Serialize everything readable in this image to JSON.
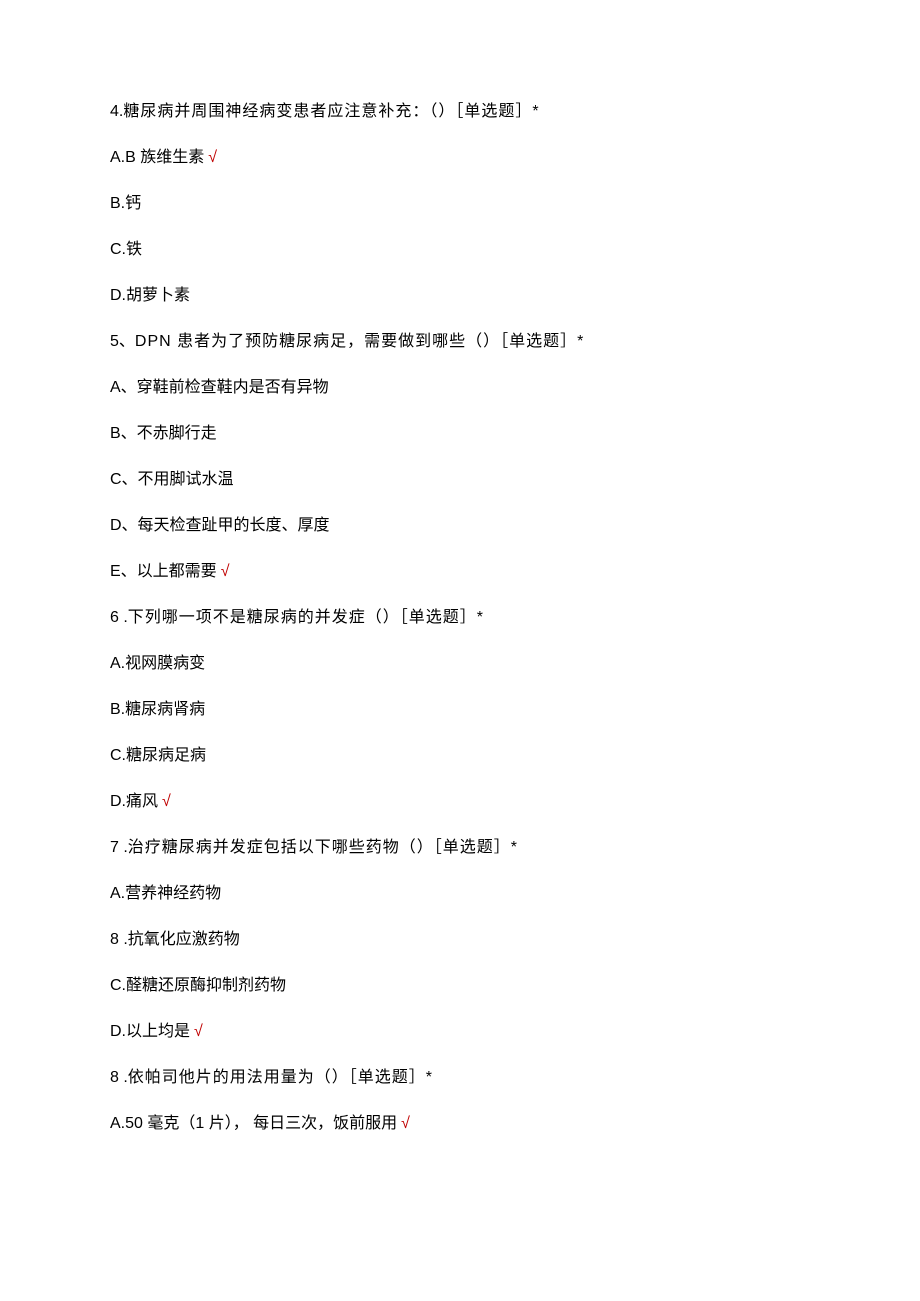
{
  "questions": [
    {
      "number": "4",
      "sep": ".",
      "text": "糖尿病并周围神经病变患者应注意补充：（）［单选题］*",
      "options": [
        {
          "label": "A.B 族维生素",
          "correct": true
        },
        {
          "label": "B.钙",
          "correct": false
        },
        {
          "label": "C.铁",
          "correct": false
        },
        {
          "label": "D.胡萝卜素",
          "correct": false
        }
      ]
    },
    {
      "number": "5",
      "sep": "、",
      "text": "DPN 患者为了预防糖尿病足，需要做到哪些（）［单选题］*",
      "options": [
        {
          "label": "A、穿鞋前检查鞋内是否有异物",
          "correct": false
        },
        {
          "label": "B、不赤脚行走",
          "correct": false
        },
        {
          "label": "C、不用脚试水温",
          "correct": false
        },
        {
          "label": "D、每天检查趾甲的长度、厚度",
          "correct": false
        },
        {
          "label": "E、以上都需要",
          "correct": true
        }
      ]
    },
    {
      "number": "6",
      "sep": "   .",
      "text": "下列哪一项不是糖尿病的并发症（）［单选题］*",
      "options": [
        {
          "label": "A.视网膜病变",
          "correct": false
        },
        {
          "label": "B.糖尿病肾病",
          "correct": false
        },
        {
          "label": "C.糖尿病足病",
          "correct": false
        },
        {
          "label": "D.痛风",
          "correct": true
        }
      ]
    },
    {
      "number": "7",
      "sep": "   .",
      "text": "治疗糖尿病并发症包括以下哪些药物（）［单选题］*",
      "options": [
        {
          "label": "A.营养神经药物",
          "correct": false
        },
        {
          "label": "8   .抗氧化应激药物",
          "correct": false
        },
        {
          "label": "C.醛糖还原酶抑制剂药物",
          "correct": false
        },
        {
          "label": "D.以上均是",
          "correct": true
        }
      ]
    },
    {
      "number": "8",
      "sep": "   .",
      "text": "依帕司他片的用法用量为（）［单选题］*",
      "options": [
        {
          "label": "A.50 毫克（1 片），  每日三次，饭前服用",
          "correct": true
        }
      ]
    }
  ],
  "check_symbol": "√"
}
